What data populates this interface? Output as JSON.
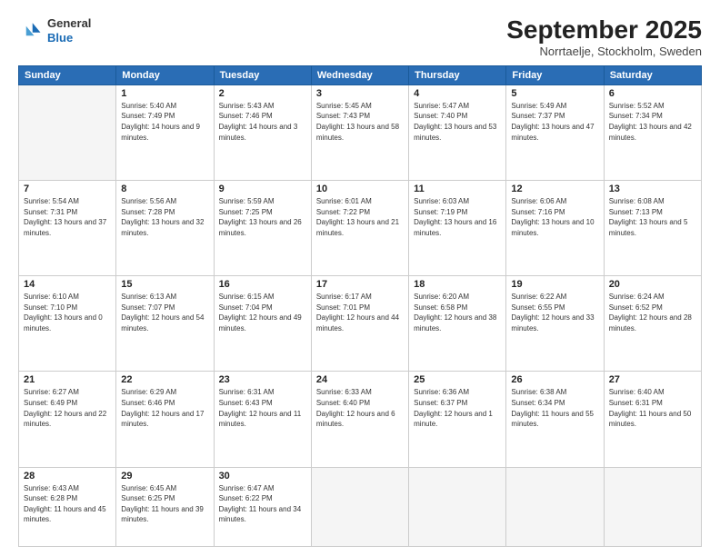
{
  "logo": {
    "line1": "General",
    "line2": "Blue"
  },
  "title": "September 2025",
  "location": "Norrtaelje, Stockholm, Sweden",
  "weekdays": [
    "Sunday",
    "Monday",
    "Tuesday",
    "Wednesday",
    "Thursday",
    "Friday",
    "Saturday"
  ],
  "weeks": [
    [
      {
        "day": null
      },
      {
        "day": 1,
        "sunrise": "5:40 AM",
        "sunset": "7:49 PM",
        "daylight": "14 hours and 9 minutes."
      },
      {
        "day": 2,
        "sunrise": "5:43 AM",
        "sunset": "7:46 PM",
        "daylight": "14 hours and 3 minutes."
      },
      {
        "day": 3,
        "sunrise": "5:45 AM",
        "sunset": "7:43 PM",
        "daylight": "13 hours and 58 minutes."
      },
      {
        "day": 4,
        "sunrise": "5:47 AM",
        "sunset": "7:40 PM",
        "daylight": "13 hours and 53 minutes."
      },
      {
        "day": 5,
        "sunrise": "5:49 AM",
        "sunset": "7:37 PM",
        "daylight": "13 hours and 47 minutes."
      },
      {
        "day": 6,
        "sunrise": "5:52 AM",
        "sunset": "7:34 PM",
        "daylight": "13 hours and 42 minutes."
      }
    ],
    [
      {
        "day": 7,
        "sunrise": "5:54 AM",
        "sunset": "7:31 PM",
        "daylight": "13 hours and 37 minutes."
      },
      {
        "day": 8,
        "sunrise": "5:56 AM",
        "sunset": "7:28 PM",
        "daylight": "13 hours and 32 minutes."
      },
      {
        "day": 9,
        "sunrise": "5:59 AM",
        "sunset": "7:25 PM",
        "daylight": "13 hours and 26 minutes."
      },
      {
        "day": 10,
        "sunrise": "6:01 AM",
        "sunset": "7:22 PM",
        "daylight": "13 hours and 21 minutes."
      },
      {
        "day": 11,
        "sunrise": "6:03 AM",
        "sunset": "7:19 PM",
        "daylight": "13 hours and 16 minutes."
      },
      {
        "day": 12,
        "sunrise": "6:06 AM",
        "sunset": "7:16 PM",
        "daylight": "13 hours and 10 minutes."
      },
      {
        "day": 13,
        "sunrise": "6:08 AM",
        "sunset": "7:13 PM",
        "daylight": "13 hours and 5 minutes."
      }
    ],
    [
      {
        "day": 14,
        "sunrise": "6:10 AM",
        "sunset": "7:10 PM",
        "daylight": "13 hours and 0 minutes."
      },
      {
        "day": 15,
        "sunrise": "6:13 AM",
        "sunset": "7:07 PM",
        "daylight": "12 hours and 54 minutes."
      },
      {
        "day": 16,
        "sunrise": "6:15 AM",
        "sunset": "7:04 PM",
        "daylight": "12 hours and 49 minutes."
      },
      {
        "day": 17,
        "sunrise": "6:17 AM",
        "sunset": "7:01 PM",
        "daylight": "12 hours and 44 minutes."
      },
      {
        "day": 18,
        "sunrise": "6:20 AM",
        "sunset": "6:58 PM",
        "daylight": "12 hours and 38 minutes."
      },
      {
        "day": 19,
        "sunrise": "6:22 AM",
        "sunset": "6:55 PM",
        "daylight": "12 hours and 33 minutes."
      },
      {
        "day": 20,
        "sunrise": "6:24 AM",
        "sunset": "6:52 PM",
        "daylight": "12 hours and 28 minutes."
      }
    ],
    [
      {
        "day": 21,
        "sunrise": "6:27 AM",
        "sunset": "6:49 PM",
        "daylight": "12 hours and 22 minutes."
      },
      {
        "day": 22,
        "sunrise": "6:29 AM",
        "sunset": "6:46 PM",
        "daylight": "12 hours and 17 minutes."
      },
      {
        "day": 23,
        "sunrise": "6:31 AM",
        "sunset": "6:43 PM",
        "daylight": "12 hours and 11 minutes."
      },
      {
        "day": 24,
        "sunrise": "6:33 AM",
        "sunset": "6:40 PM",
        "daylight": "12 hours and 6 minutes."
      },
      {
        "day": 25,
        "sunrise": "6:36 AM",
        "sunset": "6:37 PM",
        "daylight": "12 hours and 1 minute."
      },
      {
        "day": 26,
        "sunrise": "6:38 AM",
        "sunset": "6:34 PM",
        "daylight": "11 hours and 55 minutes."
      },
      {
        "day": 27,
        "sunrise": "6:40 AM",
        "sunset": "6:31 PM",
        "daylight": "11 hours and 50 minutes."
      }
    ],
    [
      {
        "day": 28,
        "sunrise": "6:43 AM",
        "sunset": "6:28 PM",
        "daylight": "11 hours and 45 minutes."
      },
      {
        "day": 29,
        "sunrise": "6:45 AM",
        "sunset": "6:25 PM",
        "daylight": "11 hours and 39 minutes."
      },
      {
        "day": 30,
        "sunrise": "6:47 AM",
        "sunset": "6:22 PM",
        "daylight": "11 hours and 34 minutes."
      },
      {
        "day": null
      },
      {
        "day": null
      },
      {
        "day": null
      },
      {
        "day": null
      }
    ]
  ]
}
